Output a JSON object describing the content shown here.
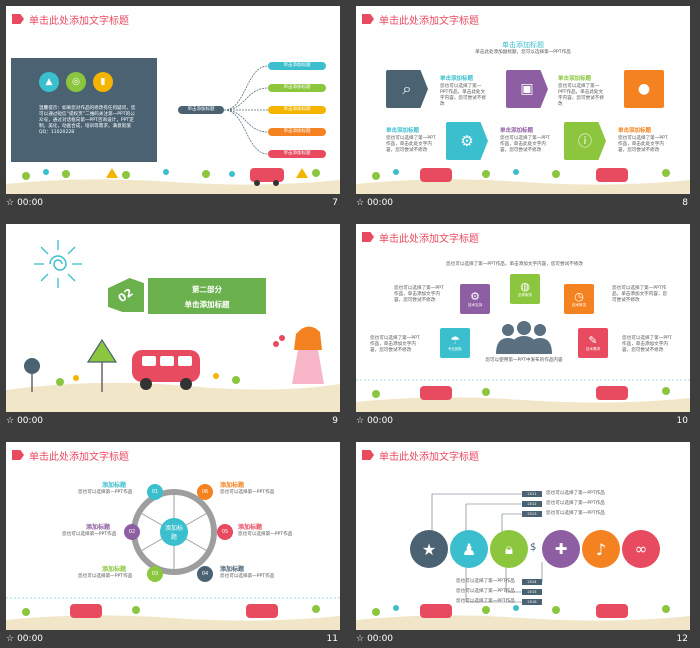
{
  "colors": {
    "accent": "#e84a5f",
    "teal": "#3bbfce",
    "green": "#8cc63f",
    "orange": "#f58220",
    "purple": "#8e5ea2",
    "dark": "#4a6272",
    "yellow": "#f4b400"
  },
  "slides": [
    {
      "num": "7",
      "time": "00:00",
      "title": "单击此处添加文字标题",
      "center_label": "单击添加标题",
      "pills": [
        "单击添加标题",
        "单击添加标题",
        "单击添加标题",
        "单击添加标题",
        "单击添加标题"
      ],
      "panel_text": "温馨提示：如果您对作品的修改有任何疑问，您可以通过短信“提权页”二维码关注第一PPT的公众号，通过对话框向第一PPT咨询设计，PPT定制，美化，动画合成，培训等需求，满意就值QQ：11020228"
    },
    {
      "num": "8",
      "time": "00:00",
      "title": "单击此处添加文字标题",
      "heading": "单击添加标题",
      "subheading": "单击此处添加副标题，您可以选择第一PPT作品",
      "item_label": "单击添加标题",
      "item_text": "您也可以选择了第一PPT作品，单击此处文字内容，您可尝试不修改"
    },
    {
      "num": "9",
      "time": "00:00",
      "part": "第二部分",
      "banner_title": "单击添加标题",
      "badge": "02"
    },
    {
      "num": "10",
      "time": "00:00",
      "title": "单击此处添加文字标题",
      "intro": "您也可以选择了第一PPT作品，单击添加文字内容，您可尝试不修改",
      "side_text": "您也可以选择了第一PPT作品，单击添加文字内容，您可尝试不修改",
      "icon_labels": [
        "技术支持",
        "全球服务",
        "技术研发",
        "专业团队",
        "技术需求"
      ],
      "company": "您可以使用第一PPT中发布的作品内容"
    },
    {
      "num": "11",
      "time": "00:00",
      "title": "单击此处添加文字标题",
      "hub": "添加标题",
      "nodes": [
        "01",
        "02",
        "03",
        "04",
        "05",
        "06"
      ],
      "node_label": "添加标题",
      "node_text": "您也可以选择第一PPT作品"
    },
    {
      "num": "12",
      "time": "00:00",
      "title": "单击此处添加文字标题",
      "years_top": [
        "2011",
        "2012",
        "2013"
      ],
      "years_bottom": [
        "2014",
        "2015",
        "2016"
      ],
      "line_text": "您也可以选择了第一PPT作品"
    }
  ]
}
